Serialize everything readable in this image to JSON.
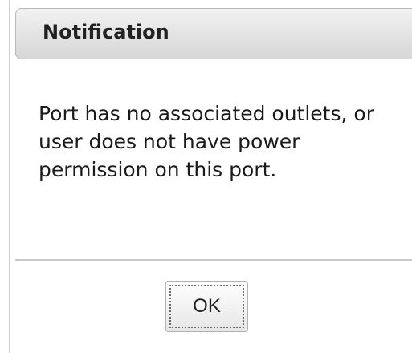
{
  "dialog": {
    "title": "Notification",
    "message": "Port has no associated outlets, or user does not have power permission on this port.",
    "ok_label": "OK"
  },
  "colors": {
    "header_gradient_top": "#f2f2f2",
    "header_gradient_bottom": "#d6d6d6",
    "text": "#1a1a1a",
    "divider": "#c9c9c9"
  }
}
